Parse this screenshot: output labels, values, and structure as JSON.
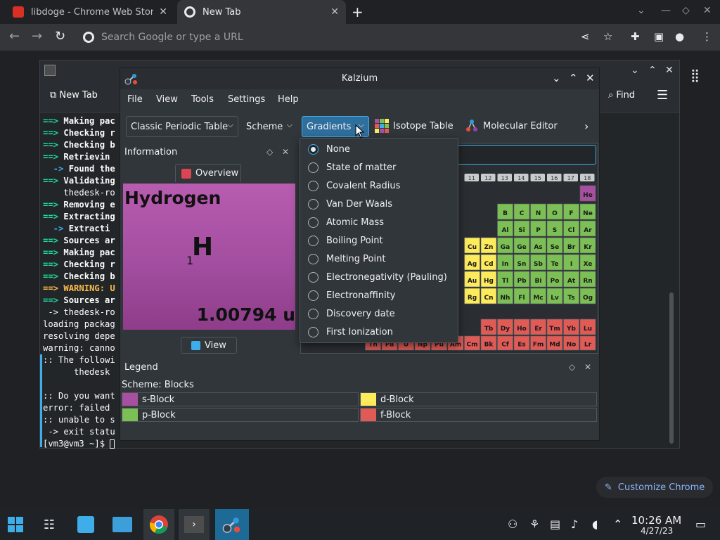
{
  "browser": {
    "tabs": [
      {
        "title": "libdoge - Chrome Web Store",
        "favicon_color": "#d93025"
      },
      {
        "title": "New Tab",
        "favicon_color": "#e8eaed"
      }
    ],
    "omnibox_placeholder": "Search Google or type a URL",
    "customize_label": "Customize Chrome"
  },
  "terminal": {
    "newtab_label": "New Tab",
    "find_label": "Find",
    "lines": [
      {
        "p": "==>",
        "pc": "arr",
        "t": " Making pac",
        "tc": "bw"
      },
      {
        "p": "==>",
        "pc": "arr",
        "t": " Checking r",
        "tc": "bw"
      },
      {
        "p": "==>",
        "pc": "arr",
        "t": " Checking b",
        "tc": "bw"
      },
      {
        "p": "==>",
        "pc": "arr",
        "t": " Retrievin",
        "tc": "bw"
      },
      {
        "p": "  ->",
        "pc": "ar2",
        "t": " Found the",
        "tc": "bw"
      },
      {
        "p": "==>",
        "pc": "arr",
        "t": " Validating",
        "tc": "bw"
      },
      {
        "p": "",
        "pc": "",
        "t": "    thedesk-ro",
        "tc": ""
      },
      {
        "p": "==>",
        "pc": "arr",
        "t": " Removing e",
        "tc": "bw"
      },
      {
        "p": "==>",
        "pc": "arr",
        "t": " Extracting",
        "tc": "bw"
      },
      {
        "p": "  ->",
        "pc": "ar2",
        "t": " Extracti",
        "tc": "bw"
      },
      {
        "p": "==>",
        "pc": "arr",
        "t": " Sources ar",
        "tc": "bw"
      },
      {
        "p": "==>",
        "pc": "arr",
        "t": " Making pac",
        "tc": "bw"
      },
      {
        "p": "==>",
        "pc": "arr",
        "t": " Checking r",
        "tc": "bw"
      },
      {
        "p": "==>",
        "pc": "arr",
        "t": " Checking b",
        "tc": "bw"
      },
      {
        "p": "==>",
        "pc": "warn",
        "t": " WARNING: U",
        "tc": "warn"
      },
      {
        "p": "==>",
        "pc": "arr",
        "t": " Sources ar",
        "tc": "bw"
      },
      {
        "p": "",
        "pc": "",
        "t": " -> thedesk-ro",
        "tc": ""
      },
      {
        "p": "",
        "pc": "",
        "t": "loading packag",
        "tc": ""
      },
      {
        "p": "",
        "pc": "",
        "t": "resolving depe",
        "tc": ""
      },
      {
        "p": "",
        "pc": "",
        "t": "warning: canno",
        "tc": ""
      },
      {
        "p": "",
        "pc": "",
        "t": ":: The followi",
        "tc": ""
      },
      {
        "p": "",
        "pc": "",
        "t": "      thedesk",
        "tc": ""
      },
      {
        "p": "",
        "pc": "",
        "t": "",
        "tc": ""
      },
      {
        "p": "",
        "pc": "",
        "t": ":: Do you want",
        "tc": ""
      },
      {
        "p": "",
        "pc": "",
        "t": "error: failed",
        "tc": ""
      },
      {
        "p": "",
        "pc": "",
        "t": ":: unable to s",
        "tc": ""
      },
      {
        "p": "",
        "pc": "",
        "t": " -> exit statu",
        "tc": ""
      },
      {
        "p": "",
        "pc": "",
        "t": "[vm3@vm3 ~]$ ",
        "tc": ""
      }
    ]
  },
  "kalzium": {
    "title": "Kalzium",
    "menu": [
      "File",
      "View",
      "Tools",
      "Settings",
      "Help"
    ],
    "toolbar": {
      "table_combo": "Classic Periodic Table",
      "scheme_combo": "Scheme",
      "gradients_combo": "Gradients",
      "isotope_btn": "Isotope Table",
      "molecular_btn": "Molecular Editor"
    },
    "info": {
      "title": "Information",
      "tab": "Overview",
      "element_name": "Hydrogen",
      "symbol": "H",
      "number": "1",
      "mass": "1.00794 u",
      "view_btn": "View"
    },
    "gradients_menu": {
      "selected": 0,
      "items": [
        "None",
        "State of matter",
        "Covalent Radius",
        "Van Der Waals",
        "Atomic Mass",
        "Boiling Point",
        "Melting Point",
        "Electronegativity (Pauling)",
        "Electronaffinity",
        "Discovery date",
        "First Ionization"
      ]
    },
    "legend": {
      "title": "Legend",
      "scheme": "Scheme: Blocks",
      "items": [
        {
          "label": "s-Block",
          "color": "#a6509f"
        },
        {
          "label": "d-Block",
          "color": "#fdeb5c"
        },
        {
          "label": "p-Block",
          "color": "#7cc055"
        },
        {
          "label": "f-Block",
          "color": "#e05a56"
        }
      ]
    },
    "table": {
      "group_headers": [
        "11",
        "12",
        "13",
        "14",
        "15",
        "16",
        "17",
        "18"
      ],
      "rows": [
        [
          {
            "s": "He",
            "b": "s"
          }
        ],
        [
          {
            "s": "B",
            "b": "p"
          },
          {
            "s": "C",
            "b": "p"
          },
          {
            "s": "N",
            "b": "p"
          },
          {
            "s": "O",
            "b": "p"
          },
          {
            "s": "F",
            "b": "p"
          },
          {
            "s": "Ne",
            "b": "p"
          }
        ],
        [
          {
            "s": "Al",
            "b": "p"
          },
          {
            "s": "Si",
            "b": "p"
          },
          {
            "s": "P",
            "b": "p"
          },
          {
            "s": "S",
            "b": "p"
          },
          {
            "s": "Cl",
            "b": "p"
          },
          {
            "s": "Ar",
            "b": "p"
          }
        ],
        [
          {
            "s": "Cu",
            "b": "d"
          },
          {
            "s": "Zn",
            "b": "d"
          },
          {
            "s": "Ga",
            "b": "p"
          },
          {
            "s": "Ge",
            "b": "p"
          },
          {
            "s": "As",
            "b": "p"
          },
          {
            "s": "Se",
            "b": "p"
          },
          {
            "s": "Br",
            "b": "p"
          },
          {
            "s": "Kr",
            "b": "p"
          }
        ],
        [
          {
            "s": "Ag",
            "b": "d"
          },
          {
            "s": "Cd",
            "b": "d"
          },
          {
            "s": "In",
            "b": "p"
          },
          {
            "s": "Sn",
            "b": "p"
          },
          {
            "s": "Sb",
            "b": "p"
          },
          {
            "s": "Te",
            "b": "p"
          },
          {
            "s": "I",
            "b": "p"
          },
          {
            "s": "Xe",
            "b": "p"
          }
        ],
        [
          {
            "s": "Au",
            "b": "d"
          },
          {
            "s": "Hg",
            "b": "d"
          },
          {
            "s": "Tl",
            "b": "p"
          },
          {
            "s": "Pb",
            "b": "p"
          },
          {
            "s": "Bi",
            "b": "p"
          },
          {
            "s": "Po",
            "b": "p"
          },
          {
            "s": "At",
            "b": "p"
          },
          {
            "s": "Rn",
            "b": "p"
          }
        ],
        [
          {
            "s": "Rg",
            "b": "d"
          },
          {
            "s": "Cn",
            "b": "d"
          },
          {
            "s": "Nh",
            "b": "p"
          },
          {
            "s": "Fl",
            "b": "p"
          },
          {
            "s": "Mc",
            "b": "p"
          },
          {
            "s": "Lv",
            "b": "p"
          },
          {
            "s": "Ts",
            "b": "p"
          },
          {
            "s": "Og",
            "b": "p"
          }
        ]
      ],
      "lanthanides": [
        "Tb",
        "Dy",
        "Ho",
        "Er",
        "Tm",
        "Yb",
        "Lu"
      ],
      "actinides": [
        "Th",
        "Pa",
        "U",
        "Np",
        "Pu",
        "Am",
        "Cm",
        "Bk",
        "Cf",
        "Es",
        "Fm",
        "Md",
        "No",
        "Lr"
      ]
    }
  },
  "taskbar": {
    "time": "10:26 AM",
    "date": "4/27/23"
  },
  "colors": {
    "s_block": "#a6509f",
    "p_block": "#7cc055",
    "d_block": "#fdeb5c",
    "f_block": "#e05a56",
    "accent": "#3daee9"
  }
}
